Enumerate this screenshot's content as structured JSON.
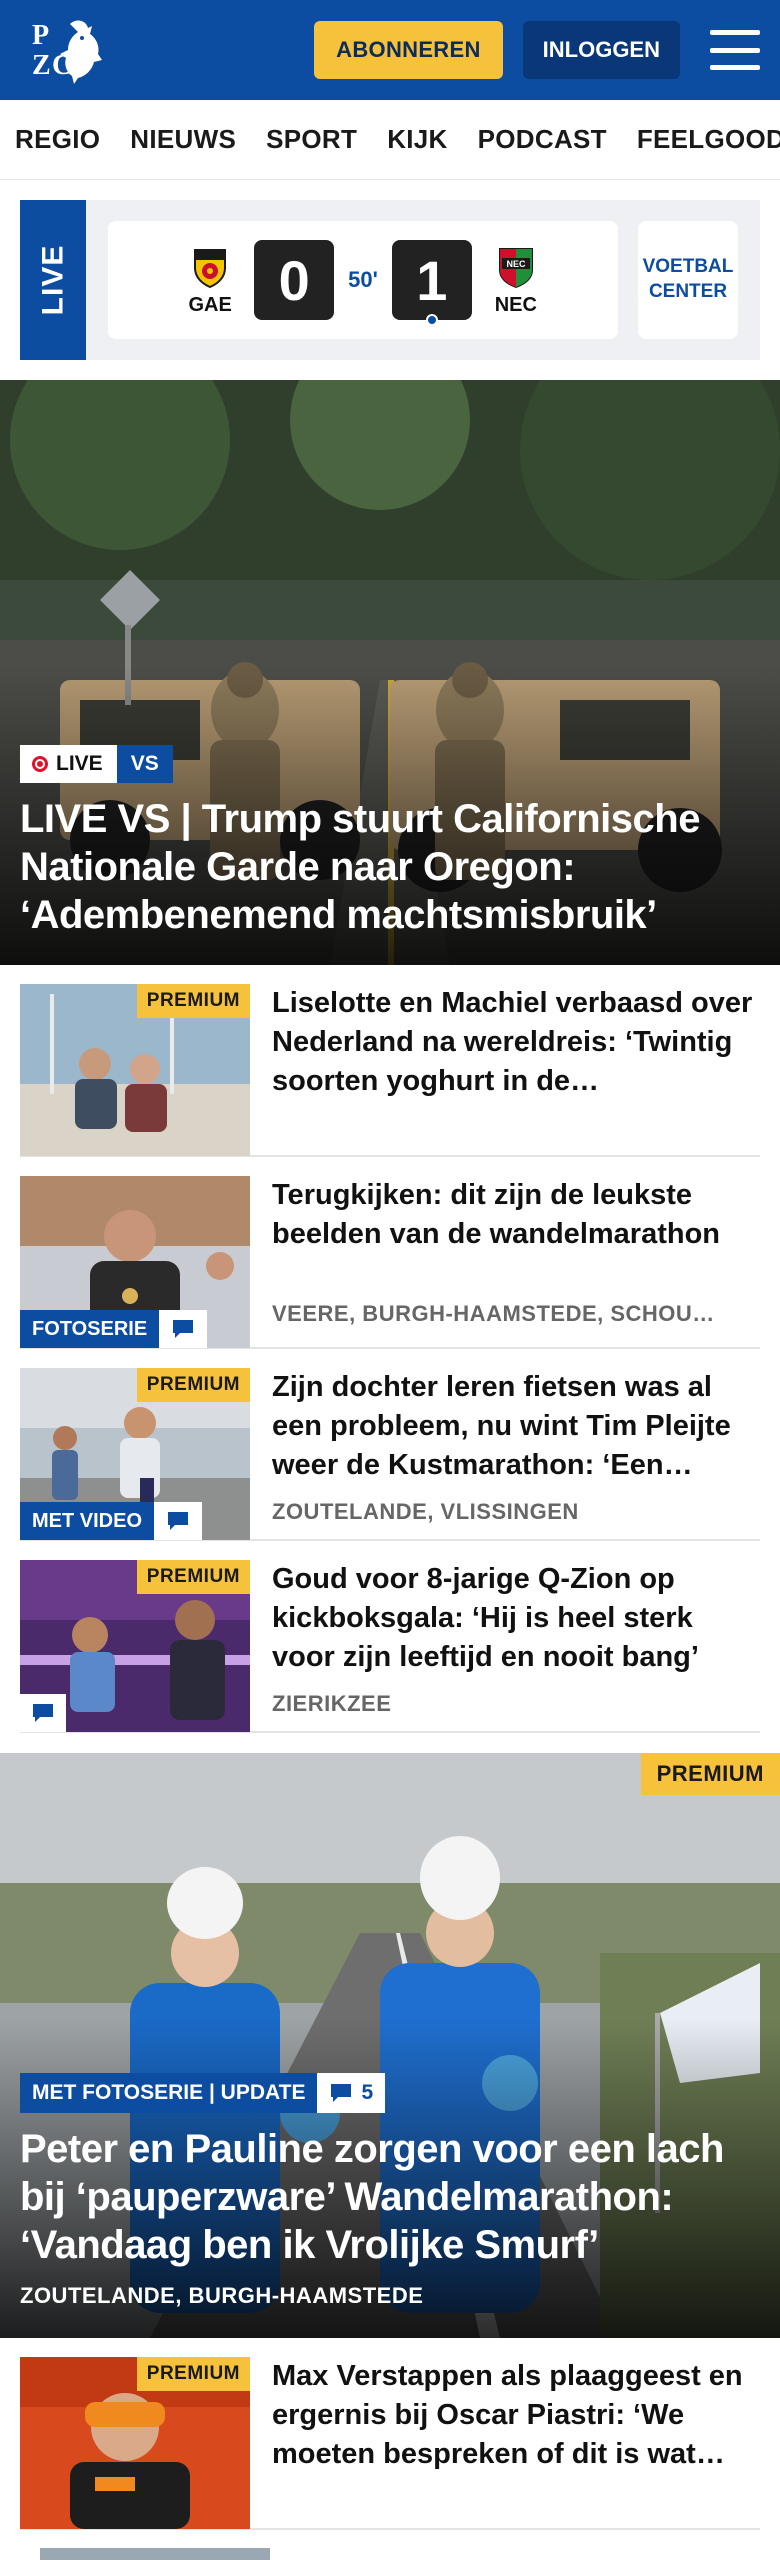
{
  "header": {
    "subscribe_label": "ABONNEREN",
    "login_label": "INLOGGEN",
    "brand_color": "#0c4da2",
    "accent_color": "#f6c23b"
  },
  "nav": {
    "items": [
      "REGIO",
      "NIEUWS",
      "SPORT",
      "KIJK",
      "PODCAST",
      "FEELGOOD"
    ]
  },
  "live_score": {
    "tag": "LIVE",
    "home_team": "GAE",
    "home_score": "0",
    "minute": "50'",
    "away_team": "NEC",
    "away_score": "1",
    "center_link": "VOETBAL CENTER"
  },
  "hero": {
    "label_live": "LIVE",
    "label_section": "VS",
    "title": "LIVE VS | Trump stuurt Californische Nationale Garde naar Oregon: ‘Adembenemend machtsmisbruik’"
  },
  "articles": [
    {
      "title": "Liselotte en Machiel verbaasd over Nederland na wereldreis: ‘Twintig soorten yoghurt in de…",
      "location": "",
      "premium": "PREMIUM",
      "label": "",
      "comment_icon": ""
    },
    {
      "title": "Terugkijken: dit zijn de leukste beelden van de wandelmarathon",
      "location": "VEERE, BURGH-HAAMSTEDE, SCHOU…",
      "premium": "",
      "label": "FOTOSERIE",
      "comment_icon": "comment-icon"
    },
    {
      "title": "Zijn dochter leren fietsen was al een probleem, nu wint Tim Pleijte weer de Kustmarathon: ‘Een…",
      "location": "ZOUTELANDE, VLISSINGEN",
      "premium": "PREMIUM",
      "label": "MET VIDEO",
      "comment_icon": "comment-icon"
    },
    {
      "title": "Goud voor 8-jarige Q-Zion op kickboksgala: ‘Hij is heel sterk voor zijn leeftijd en nooit bang’",
      "location": "ZIERIKZEE",
      "premium": "PREMIUM",
      "label": "",
      "comment_icon": "comment-icon"
    }
  ],
  "feature": {
    "premium": "PREMIUM",
    "label": "MET FOTOSERIE | UPDATE",
    "comment_count": "5",
    "title": "Peter en Pauline zorgen voor een lach bij ‘pauperzware’ Wandelmarathon: ‘Vandaag ben ik Vrolijke Smurf’",
    "location": "ZOUTELANDE, BURGH-HAAMSTEDE"
  },
  "articles_2": [
    {
      "title": "Max Verstappen als plaaggeest en ergernis bij Oscar Piastri: ‘We moeten bespreken of dit is wat…",
      "premium": "PREMIUM"
    }
  ]
}
